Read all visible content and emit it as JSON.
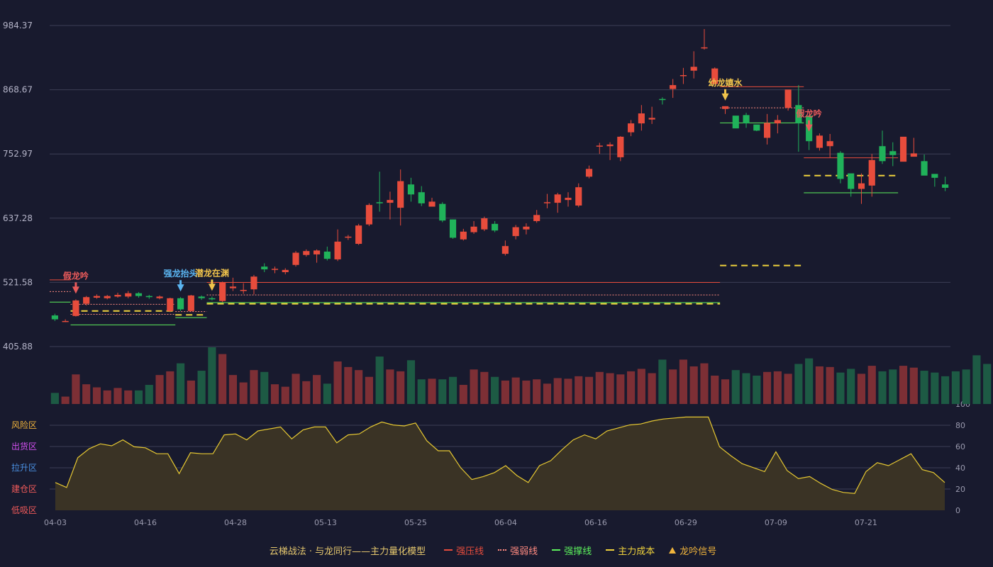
{
  "colors": {
    "up": "#e74c3c",
    "down": "#20b25a",
    "vol_up": "#7d2f35",
    "vol_down": "#1d5a44",
    "grid": "#3c3e55",
    "pressure": "#e74c3c",
    "weak": "#ff8a80",
    "support": "#5cf05c",
    "cost": "#f0d23c",
    "osc_line": "#e6c832",
    "osc_fill": "#3a3325"
  },
  "price_axis": {
    "ticks": [
      "984.37",
      "868.67",
      "752.97",
      "637.28",
      "521.58",
      "405.88"
    ],
    "min": 405.88,
    "max": 984.37
  },
  "osc_axis": {
    "ticks": [
      "100",
      "80",
      "60",
      "40",
      "20",
      "0"
    ],
    "tick_colors": [
      "#5cf05c",
      "#f0b43c",
      "#c850f0",
      "#4a90e2",
      "#e74c3c",
      "#e74c3c"
    ]
  },
  "zones": [
    {
      "label": "风险区",
      "color": "#f0b43c"
    },
    {
      "label": "出货区",
      "color": "#d250f0"
    },
    {
      "label": "拉升区",
      "color": "#4a90e2"
    },
    {
      "label": "建仓区",
      "color": "#f05a5a"
    },
    {
      "label": "低吸区",
      "color": "#f05a5a"
    }
  ],
  "x_axis": {
    "labels": [
      {
        "label": "04-03",
        "index": 0
      },
      {
        "label": "04-16",
        "index": 8
      },
      {
        "label": "04-28",
        "index": 16
      },
      {
        "label": "05-13",
        "index": 24
      },
      {
        "label": "05-25",
        "index": 32
      },
      {
        "label": "06-04",
        "index": 40
      },
      {
        "label": "06-16",
        "index": 48
      },
      {
        "label": "06-29",
        "index": 56
      },
      {
        "label": "07-09",
        "index": 64
      },
      {
        "label": "07-21",
        "index": 72
      }
    ]
  },
  "chart_data": {
    "type": "candlestick",
    "title": "云梯战法 · 与龙同行——主力量化模型",
    "ylim": [
      405.88,
      984.37
    ],
    "candles": [
      [
        462,
        455,
        465,
        452
      ],
      [
        451,
        452,
        455,
        450
      ],
      [
        461,
        489,
        491,
        460
      ],
      [
        483,
        495,
        497,
        480
      ],
      [
        494,
        497,
        500,
        492
      ],
      [
        493,
        497,
        499,
        491
      ],
      [
        496,
        499,
        503,
        494
      ],
      [
        496,
        502,
        506,
        493
      ],
      [
        502,
        497,
        504,
        494
      ],
      [
        497,
        495,
        499,
        492
      ],
      [
        493,
        496,
        498,
        491
      ],
      [
        470,
        493,
        494,
        468
      ],
      [
        493,
        473,
        495,
        470
      ],
      [
        470,
        498,
        499,
        469
      ],
      [
        496,
        493,
        498,
        490
      ],
      [
        493,
        491,
        496,
        489
      ],
      [
        488,
        521,
        523,
        486
      ],
      [
        511,
        514,
        530,
        506
      ],
      [
        506,
        508,
        520,
        501
      ],
      [
        509,
        532,
        535,
        500
      ],
      [
        550,
        545,
        556,
        540
      ],
      [
        545,
        546,
        550,
        538
      ],
      [
        540,
        544,
        547,
        536
      ],
      [
        553,
        575,
        578,
        550
      ],
      [
        571,
        578,
        581,
        568
      ],
      [
        572,
        579,
        581,
        557
      ],
      [
        577,
        564,
        586,
        561
      ],
      [
        563,
        595,
        617,
        560
      ],
      [
        603,
        604,
        607,
        598
      ],
      [
        591,
        624,
        627,
        589
      ],
      [
        626,
        661,
        664,
        623
      ],
      [
        666,
        664,
        721,
        649
      ],
      [
        665,
        670,
        685,
        635
      ],
      [
        656,
        704,
        725,
        624
      ],
      [
        698,
        680,
        710,
        667
      ],
      [
        684,
        664,
        695,
        659
      ],
      [
        658,
        667,
        674,
        662
      ],
      [
        663,
        633,
        666,
        630
      ],
      [
        635,
        602,
        635,
        600
      ],
      [
        599,
        613,
        618,
        597
      ],
      [
        612,
        622,
        632,
        609
      ],
      [
        617,
        637,
        640,
        614
      ],
      [
        627,
        615,
        632,
        612
      ],
      [
        573,
        587,
        597,
        570
      ],
      [
        605,
        621,
        625,
        599
      ],
      [
        617,
        622,
        628,
        608
      ],
      [
        632,
        643,
        652,
        629
      ],
      [
        666,
        666,
        681,
        655
      ],
      [
        665,
        680,
        683,
        647
      ],
      [
        670,
        674,
        684,
        658
      ],
      [
        660,
        693,
        700,
        657
      ],
      [
        712,
        726,
        732,
        709
      ],
      [
        768,
        768,
        773,
        753
      ],
      [
        767,
        770,
        774,
        742
      ],
      [
        747,
        784,
        785,
        740
      ],
      [
        792,
        808,
        814,
        785
      ],
      [
        808,
        826,
        841,
        795
      ],
      [
        815,
        818,
        838,
        807
      ],
      [
        852,
        851,
        855,
        842
      ],
      [
        870,
        877,
        888,
        854
      ],
      [
        895,
        895,
        908,
        879
      ],
      [
        903,
        910,
        938,
        889
      ],
      [
        944,
        945,
        978,
        941
      ],
      [
        879,
        907,
        909,
        878
      ],
      [
        834,
        839,
        839,
        825
      ],
      [
        822,
        799,
        819,
        802
      ],
      [
        823,
        808,
        827,
        800
      ],
      [
        806,
        795,
        797,
        794
      ],
      [
        782,
        809,
        825,
        770
      ],
      [
        808,
        814,
        823,
        790
      ],
      [
        836,
        869,
        860,
        831
      ],
      [
        841,
        808,
        877,
        757
      ],
      [
        822,
        776,
        783,
        760
      ],
      [
        764,
        786,
        790,
        759
      ],
      [
        767,
        776,
        789,
        747
      ],
      [
        755,
        708,
        758,
        700
      ],
      [
        718,
        690,
        717,
        676
      ],
      [
        690,
        700,
        718,
        663
      ],
      [
        696,
        742,
        753,
        676
      ],
      [
        767,
        740,
        795,
        735
      ],
      [
        758,
        751,
        774,
        731
      ],
      [
        739,
        784,
        774,
        744
      ],
      [
        748,
        754,
        782,
        751
      ],
      [
        740,
        714,
        752,
        725
      ],
      [
        717,
        710,
        716,
        694
      ],
      [
        698,
        692,
        712,
        686
      ]
    ],
    "volume": [
      18,
      12,
      48,
      32,
      27,
      22,
      26,
      22,
      22,
      31,
      47,
      53,
      66,
      38,
      54,
      92,
      81,
      47,
      35,
      55,
      52,
      32,
      28,
      49,
      37,
      47,
      33,
      69,
      60,
      55,
      44,
      77,
      56,
      53,
      71,
      40,
      41,
      40,
      44,
      31,
      56,
      52,
      44,
      38,
      43,
      38,
      40,
      33,
      42,
      41,
      45,
      44,
      52,
      50,
      48,
      53,
      57,
      50,
      72,
      56,
      72,
      61,
      66,
      46,
      40,
      55,
      50,
      46,
      52,
      53,
      49,
      65,
      74,
      61,
      60,
      51,
      57,
      49,
      62,
      53,
      56,
      62,
      59,
      54,
      51,
      45,
      53,
      56,
      79,
      65,
      56
    ],
    "osc": [
      28,
      23,
      53,
      62,
      67,
      65,
      71,
      64,
      63,
      57,
      57,
      37,
      58,
      57,
      57,
      76,
      77,
      71,
      80,
      82,
      84,
      72,
      81,
      84,
      84,
      68,
      76,
      77,
      84,
      89,
      86,
      85,
      88,
      70,
      60,
      60,
      43,
      31,
      34,
      38,
      45,
      35,
      28,
      45,
      50,
      61,
      71,
      76,
      72,
      80,
      83,
      86,
      87,
      90,
      92,
      93,
      94,
      94,
      94,
      64,
      55,
      47,
      43,
      39,
      59,
      40,
      32,
      34,
      27,
      21,
      18,
      17,
      39,
      48,
      45,
      51,
      57,
      41,
      38,
      28
    ]
  },
  "signals": [
    {
      "label": "假龙吟",
      "index": 2,
      "color": "#e85a5a"
    },
    {
      "label": "强龙抬头",
      "index": 12,
      "color": "#5ab4f0"
    },
    {
      "label": "潜龙在渊",
      "index": 15,
      "color": "#f0c34b"
    },
    {
      "label": "幼龙嬉水",
      "index": 64,
      "color": "#f0c34b"
    },
    {
      "label": "假龙吟",
      "index": 72,
      "color": "#e85a5a"
    }
  ],
  "levels": [
    {
      "type": "pressure",
      "from": 0,
      "to": 1,
      "value": 526
    },
    {
      "type": "weak",
      "from": 0,
      "to": 1,
      "value": 505
    },
    {
      "type": "support",
      "from": 0,
      "to": 1,
      "value": 486
    },
    {
      "type": "weak",
      "from": 2,
      "to": 11,
      "value": 482
    },
    {
      "type": "cost",
      "from": 2,
      "to": 11,
      "value": 470
    },
    {
      "type": "weak",
      "from": 2,
      "to": 11,
      "value": 464
    },
    {
      "type": "support",
      "from": 2,
      "to": 11,
      "value": 445
    },
    {
      "type": "weak",
      "from": 12,
      "to": 14,
      "value": 469
    },
    {
      "type": "cost",
      "from": 12,
      "to": 14,
      "value": 463
    },
    {
      "type": "support",
      "from": 12,
      "to": 14,
      "value": 458
    },
    {
      "type": "pressure",
      "from": 15,
      "to": 63,
      "value": 521.5
    },
    {
      "type": "weak",
      "from": 15,
      "to": 63,
      "value": 499
    },
    {
      "type": "support",
      "from": 15,
      "to": 63,
      "value": 485
    },
    {
      "type": "cost",
      "from": 15,
      "to": 63,
      "value": 483
    },
    {
      "type": "pressure",
      "from": 64,
      "to": 71,
      "value": 874
    },
    {
      "type": "weak",
      "from": 64,
      "to": 71,
      "value": 836
    },
    {
      "type": "support",
      "from": 64,
      "to": 71,
      "value": 809
    },
    {
      "type": "cost",
      "from": 64,
      "to": 71,
      "value": 552
    },
    {
      "type": "pressure",
      "from": 72,
      "to": 80,
      "value": 746
    },
    {
      "type": "cost",
      "from": 72,
      "to": 80,
      "value": 714
    },
    {
      "type": "support",
      "from": 72,
      "to": 80,
      "value": 683
    }
  ],
  "legend": {
    "title": "云梯战法 · 与龙同行——主力量化模型",
    "items": [
      {
        "label": "强压线",
        "color": "#e74c3c",
        "style": "solid"
      },
      {
        "label": "强弱线",
        "color": "#ff8a80",
        "style": "dot"
      },
      {
        "label": "强撑线",
        "color": "#5cf05c",
        "style": "solid"
      },
      {
        "label": "主力成本",
        "color": "#f0d23c",
        "style": "dash"
      },
      {
        "label": "龙吟信号",
        "color": "#f0b43c",
        "style": "tri"
      }
    ]
  }
}
